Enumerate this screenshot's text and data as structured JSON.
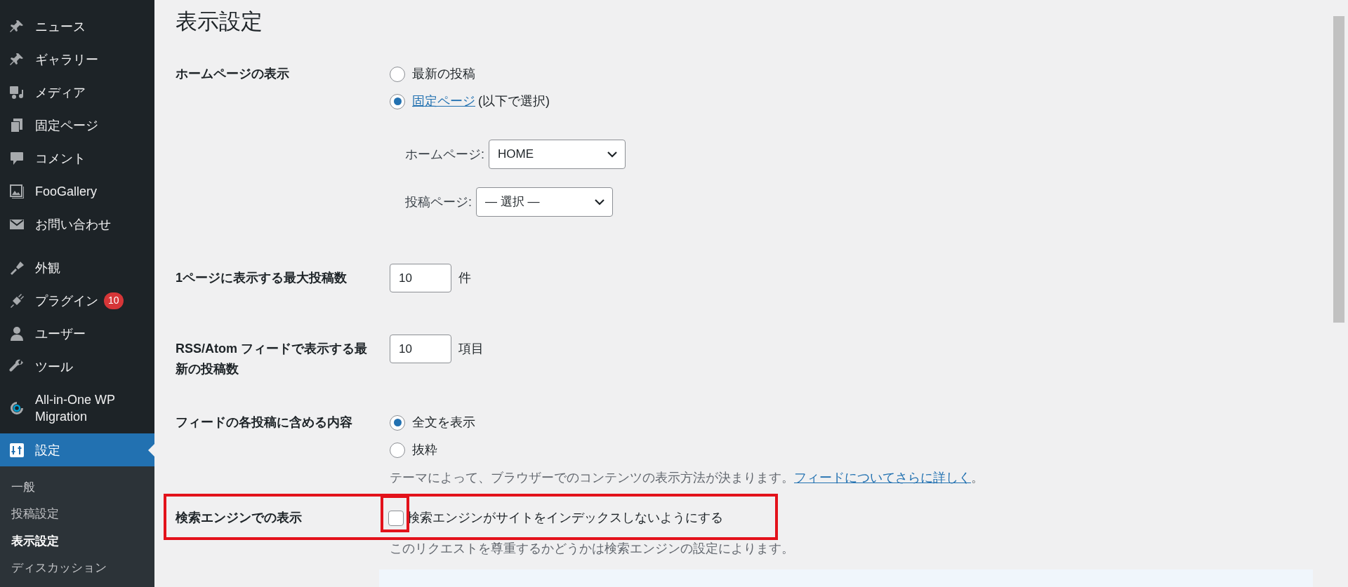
{
  "sidebar": {
    "items": [
      {
        "label": "ニュース",
        "current": false
      },
      {
        "label": "ギャラリー",
        "current": false
      },
      {
        "label": "メディア",
        "current": false
      },
      {
        "label": "固定ページ",
        "current": false
      },
      {
        "label": "コメント",
        "current": false
      },
      {
        "label": "FooGallery",
        "current": false
      },
      {
        "label": "お問い合わせ",
        "current": false
      },
      {
        "label": "外観",
        "current": false
      },
      {
        "label": "プラグイン",
        "badge": "10",
        "current": false
      },
      {
        "label": "ユーザー",
        "current": false
      },
      {
        "label": "ツール",
        "current": false
      },
      {
        "label": "All-in-One WP Migration",
        "current": false
      },
      {
        "label": "設定",
        "current": true
      }
    ],
    "submenu": [
      {
        "label": "一般",
        "current": false
      },
      {
        "label": "投稿設定",
        "current": false
      },
      {
        "label": "表示設定",
        "current": true
      },
      {
        "label": "ディスカッション",
        "current": false
      }
    ]
  },
  "page": {
    "title": "表示設定"
  },
  "settings": [
    {
      "kind": "radio-group",
      "label": "ホームページの表示",
      "options": [
        {
          "text": "最新の投稿",
          "selected": false
        },
        {
          "link": "固定ページ",
          "text": "(以下で選択)",
          "selected": true
        }
      ],
      "selects": [
        {
          "label": "ホームページ:",
          "value": "HOME"
        },
        {
          "label": "投稿ページ:",
          "value": "— 選択 —"
        }
      ]
    },
    {
      "kind": "number",
      "label": "1ページに表示する最大投稿数",
      "value": "10",
      "unit": "件"
    },
    {
      "kind": "number",
      "label": "RSS/Atom フィードで表示する最新の投稿数",
      "value": "10",
      "unit": "項目"
    },
    {
      "kind": "radio-group",
      "label": "フィードの各投稿に含める内容",
      "options": [
        {
          "text": "全文を表示",
          "selected": true
        },
        {
          "text": "抜粋",
          "selected": false
        }
      ],
      "description": "テーマによって、ブラウザーでのコンテンツの表示方法が決まります。",
      "description_link": "フィードについてさらに詳しく",
      "description_end": "。"
    },
    {
      "kind": "checkbox",
      "label": "検索エンジンでの表示",
      "highlighted": true,
      "option": {
        "text": "検索エンジンがサイトをインデックスしないようにする",
        "checked": false
      },
      "description": "このリクエストを尊重するかどうかは検索エンジンの設定によります。"
    }
  ]
}
